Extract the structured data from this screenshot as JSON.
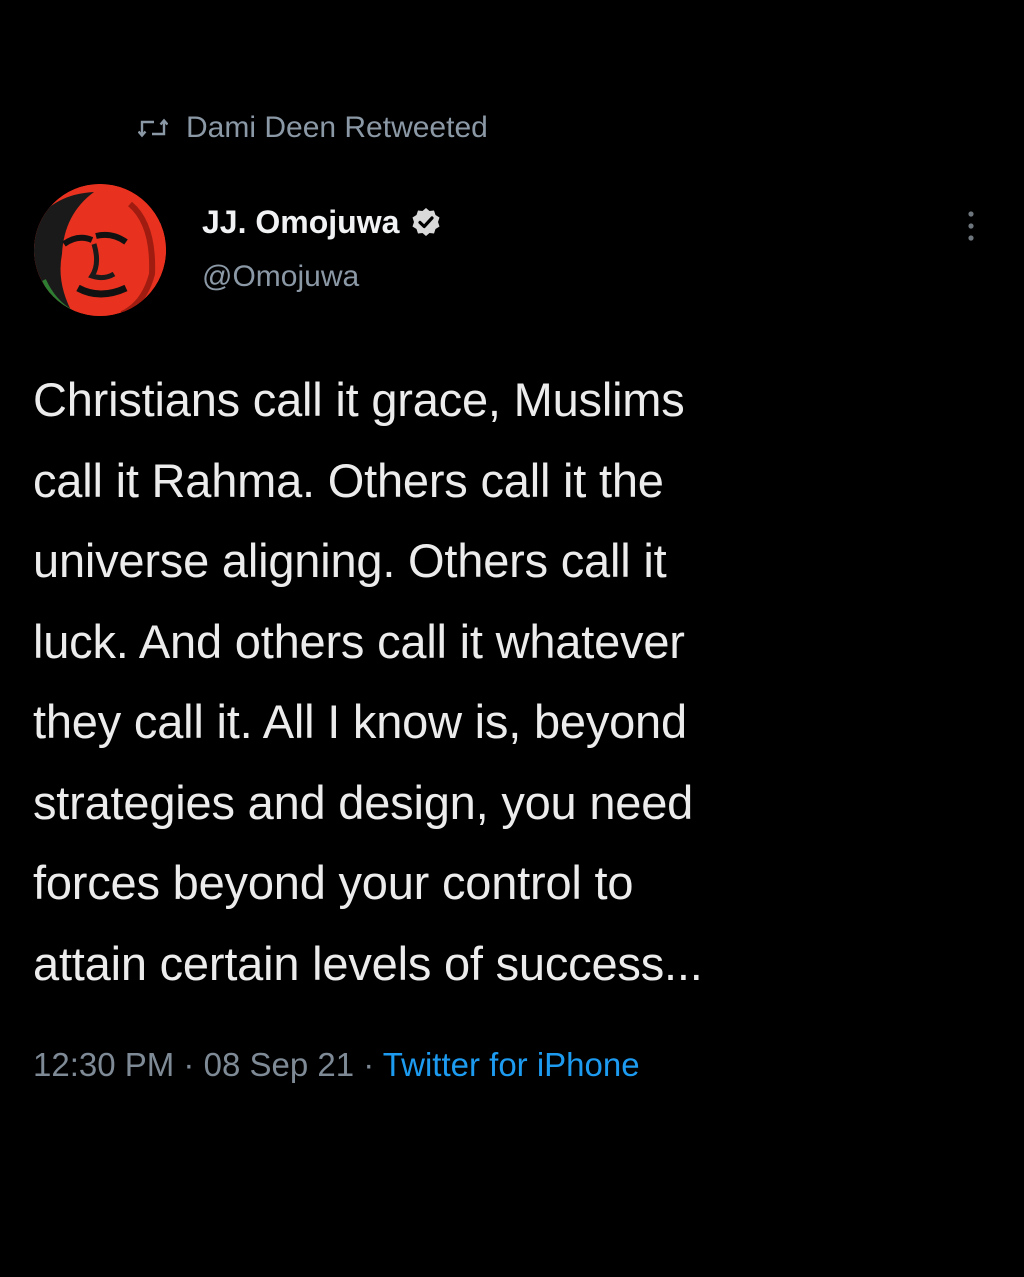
{
  "retweet": {
    "label": "Dami Deen Retweeted"
  },
  "author": {
    "display_name": "JJ. Omojuwa",
    "handle": "@Omojuwa",
    "verified": true
  },
  "tweet": {
    "lines": [
      "Christians call it grace, Muslims",
      "call it Rahma. Others call it the",
      "universe aligning. Others call it",
      "luck. And others call it whatever",
      "they call it. All I know is, beyond",
      "strategies and design, you need",
      "forces beyond your control to",
      "attain certain levels of success..."
    ]
  },
  "meta": {
    "time": "12:30 PM",
    "separator": "·",
    "date": "08 Sep 21",
    "source": "Twitter for iPhone"
  },
  "colors": {
    "background": "#000000",
    "text": "#e7e9ea",
    "muted": "#8b98a5",
    "link": "#1d9bf0",
    "avatar_red": "#e8321f"
  },
  "icons": {
    "retweet": "retweet-icon",
    "verified": "verified-badge-icon",
    "more": "more-options-icon"
  }
}
